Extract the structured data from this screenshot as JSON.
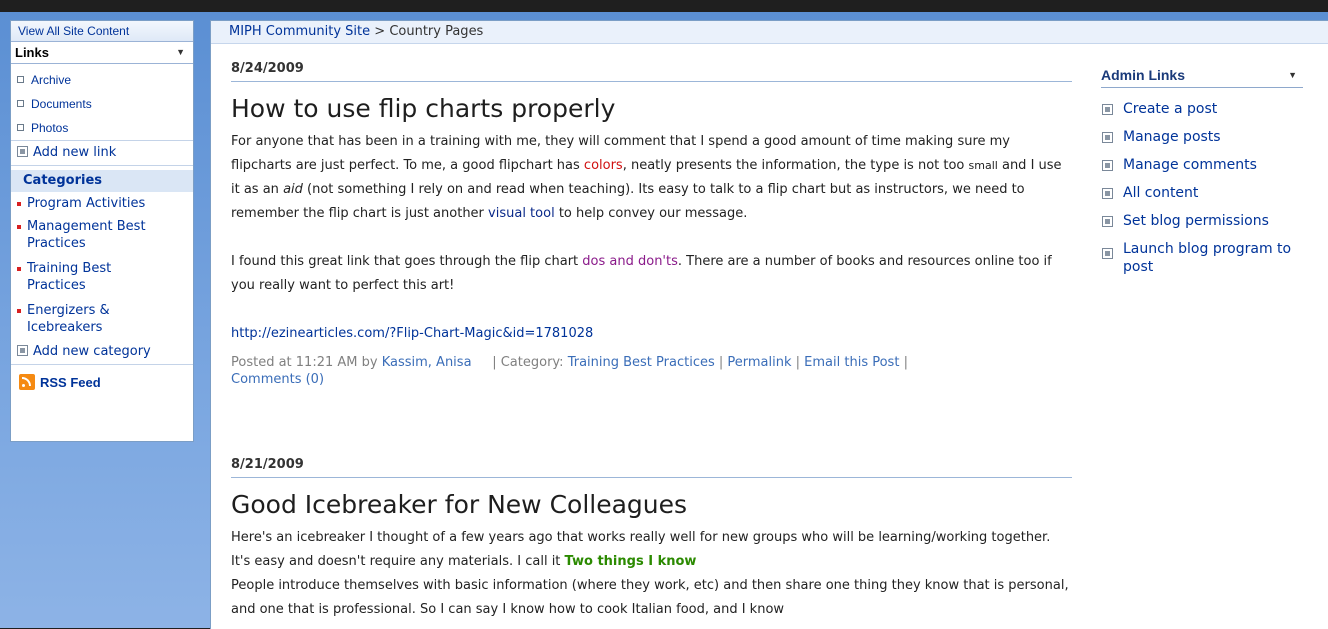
{
  "left_nav": {
    "view_all": "View All Site Content",
    "links_header": "Links",
    "links_items": [
      "Archive",
      "Documents",
      "Photos"
    ],
    "add_link": "Add new link",
    "categories_header": "Categories",
    "categories": [
      {
        "line1": "Program Activities",
        "line2": ""
      },
      {
        "line1": "Management Best",
        "line2": "Practices"
      },
      {
        "line1": "Training Best",
        "line2": "Practices"
      },
      {
        "line1": "Energizers &",
        "line2": "Icebreakers"
      }
    ],
    "add_category": "Add new category",
    "rss": "RSS Feed"
  },
  "breadcrumb": {
    "site": "MIPH Community Site",
    "sep": " > ",
    "page": "Country Pages"
  },
  "posts": [
    {
      "date": "8/24/2009",
      "title": "How to use flip charts properly",
      "p1": {
        "a": "For anyone that has been in a training with me, they will comment that I spend a good amount of time making sure my flipcharts are just perfect. To me, a good flipchart has ",
        "colors": "colors",
        "b": ", neatly presents the information, the type is not too ",
        "small": "small",
        "c": " and I use it as an ",
        "aid": "aid",
        "d": " (not something I rely on and read when teaching). Its easy to talk to a flip chart but as instructors, we need to remember the flip chart is just another ",
        "visual": "visual tool",
        "e": " to help convey our message."
      },
      "p2": {
        "a": "I found this great link that goes through the flip chart ",
        "link": "dos and don'ts",
        "b": ". There are a number of books and resources online too if you really want to perfect this art!"
      },
      "url": "http://ezinearticles.com/?Flip-Chart-Magic&id=1781028",
      "meta": {
        "posted": "Posted at 11:21 AM by ",
        "author": "Kassim, Anisa",
        "cat_label": "| Category: ",
        "category": "Training Best Practices",
        "sep": " | ",
        "permalink": "Permalink",
        "email": "Email this Post",
        "comments": "Comments (0)"
      }
    },
    {
      "date": "8/21/2009",
      "title": "Good Icebreaker for New Colleagues",
      "p1": {
        "a": "Here's an icebreaker I thought of a few years ago that works really well for new groups who will be learning/working together. It's easy and doesn't require any materials. I call it ",
        "bold": "Two things I know",
        "b": "People introduce themselves with basic information (where they work, etc) and then share one thing they know that is personal, and one that is professional. So I can say I know how to cook Italian food, and I know"
      }
    }
  ],
  "admin": {
    "header": "Admin Links",
    "items": [
      "Create a post",
      "Manage posts",
      "Manage comments",
      "All content",
      "Set blog permissions",
      "Launch blog program to post"
    ]
  }
}
